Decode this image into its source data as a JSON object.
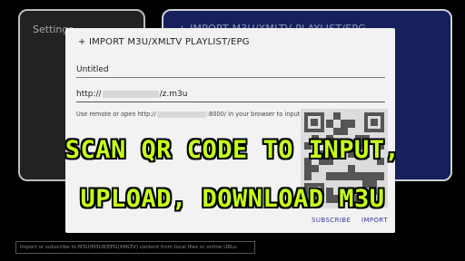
{
  "background": {
    "settings_label": "Settings",
    "import_label": "+ IMPORT M3U/XMLTV PLAYLIST/EPG"
  },
  "dialog": {
    "title": "+ IMPORT M3U/XMLTV PLAYLIST/EPG",
    "name_value": "Untitled",
    "url_prefix": "http://",
    "url_suffix": "/z.m3u",
    "hint_prefix": "Use remote or open http://",
    "hint_suffix": ":8000/ in your browser to input.",
    "subscribe_label": "SUBSCRIBE",
    "import_label": "IMPORT"
  },
  "footer_hint": "Import or subscribe to M3U/M3U8/EPG(XMLTV) content from local files or online URLs.",
  "overlay": {
    "line1": "SCAN QR CODE TO INPUT,",
    "line2": "UPLOAD, DOWNLOAD M3U"
  },
  "colors": {
    "overlay_text": "#c6ff1a",
    "accent_card": "#17205c",
    "button_text": "#3a3aa0"
  }
}
